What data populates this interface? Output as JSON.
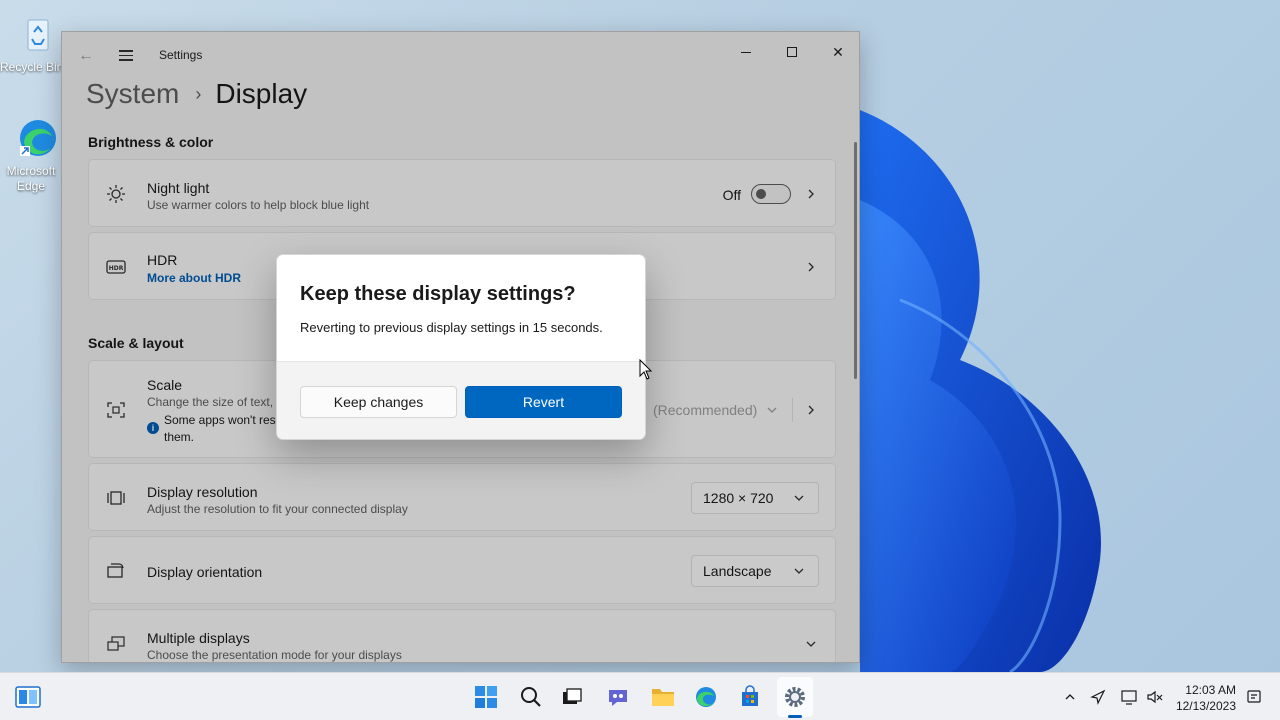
{
  "desktop": {
    "icons": [
      {
        "label": "Recycle Bin"
      },
      {
        "label": "Microsoft Edge"
      }
    ]
  },
  "window": {
    "title": "Settings",
    "breadcrumb": {
      "parent": "System",
      "current": "Display"
    },
    "sections": {
      "brightness_color": "Brightness & color",
      "scale_layout": "Scale & layout"
    },
    "night_light": {
      "title": "Night light",
      "subtitle": "Use warmer colors to help block blue light",
      "state": "Off"
    },
    "hdr": {
      "title": "HDR",
      "link": "More about HDR"
    },
    "scale": {
      "title": "Scale",
      "subtitle": "Change the size of text,",
      "warning_line1": "Some apps won't res",
      "warning_line2": "them.",
      "value": "(Recommended)"
    },
    "resolution": {
      "title": "Display resolution",
      "subtitle": "Adjust the resolution to fit your connected display",
      "value": "1280 × 720"
    },
    "orientation": {
      "title": "Display orientation",
      "value": "Landscape"
    },
    "multiple": {
      "title": "Multiple displays",
      "subtitle": "Choose the presentation mode for your displays"
    }
  },
  "dialog": {
    "title": "Keep these display settings?",
    "message": "Reverting to previous display settings in 15 seconds.",
    "keep_label": "Keep changes",
    "revert_label": "Revert"
  },
  "taskbar": {
    "clock_time": "12:03 AM",
    "clock_date": "12/13/2023"
  },
  "colors": {
    "accent": "#0067c0",
    "link": "#005fb8"
  }
}
